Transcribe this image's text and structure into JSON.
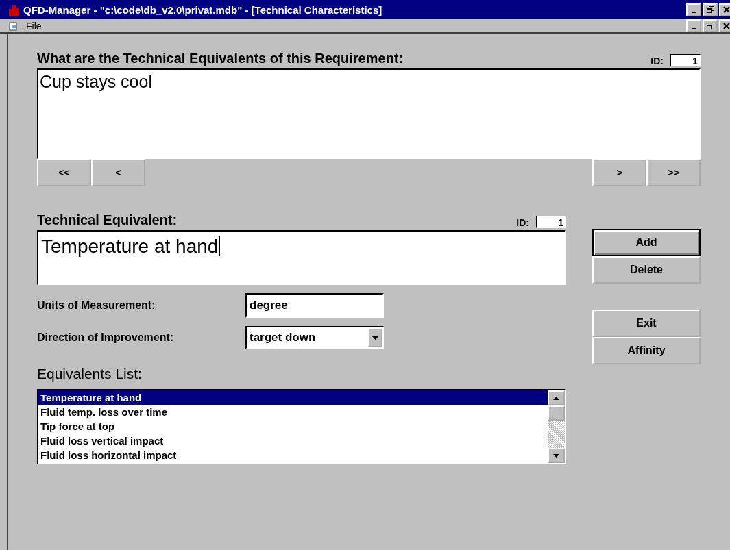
{
  "window": {
    "title": "QFD-Manager - \"c:\\code\\db_v2.0\\privat.mdb\" - [Technical Characteristics]"
  },
  "menu": [
    {
      "label": "File"
    }
  ],
  "requirement": {
    "heading": "What are the Technical Equivalents of this Requirement:",
    "id_label": "ID:",
    "id": "1",
    "text": "Cup stays cool"
  },
  "nav_buttons": [
    {
      "label": "<<"
    },
    {
      "label": "<"
    },
    {
      "label": ">"
    },
    {
      "label": ">>"
    }
  ],
  "equivalent": {
    "label": "Technical Equivalent:",
    "id_label": "ID:",
    "id": "1",
    "value": "Temperature at hand"
  },
  "units": {
    "label": "Units of Measurement:",
    "value": "degree"
  },
  "direction": {
    "label": "Direction of Improvement:",
    "value": "target down"
  },
  "buttons": [
    {
      "label": "Add",
      "default": true
    },
    {
      "label": "Delete",
      "default": false
    },
    {
      "label": "Exit",
      "default": false
    },
    {
      "label": "Affinity",
      "default": false
    }
  ],
  "list": {
    "label": "Equivalents List:",
    "items": [
      {
        "label": "Temperature at hand",
        "selected": true
      },
      {
        "label": "Fluid temp. loss over time",
        "selected": false
      },
      {
        "label": "Tip force at top",
        "selected": false
      },
      {
        "label": "Fluid loss vertical impact",
        "selected": false
      },
      {
        "label": "Fluid loss horizontal impact",
        "selected": false
      }
    ]
  }
}
